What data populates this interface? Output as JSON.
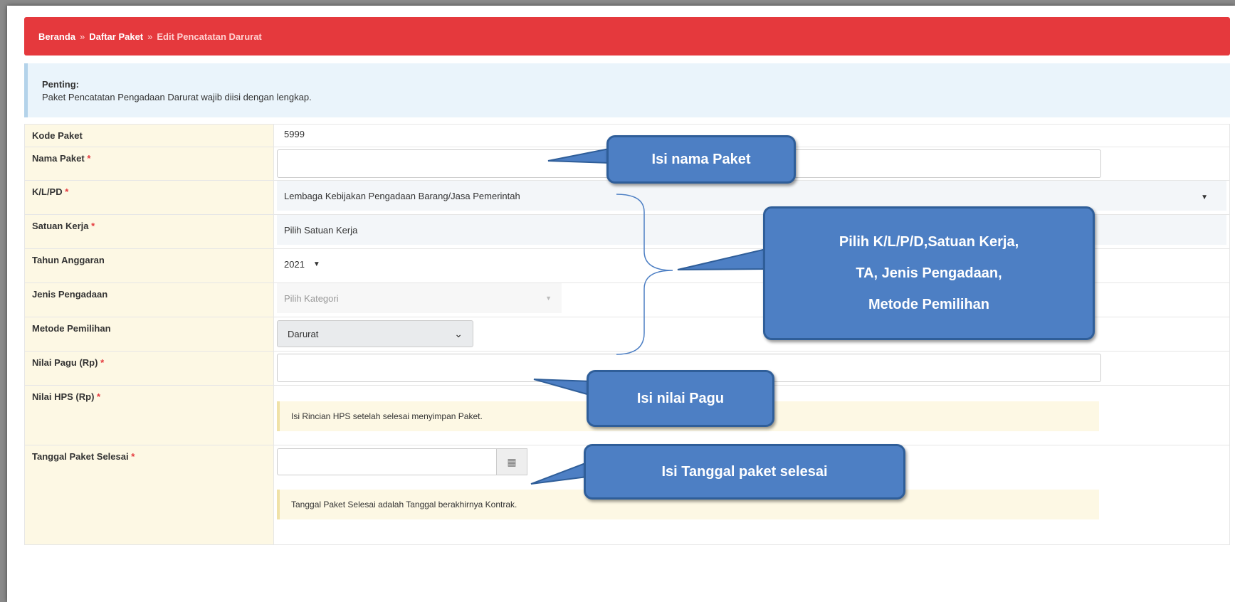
{
  "breadcrumb": {
    "home": "Beranda",
    "list": "Daftar Paket",
    "current": "Edit Pencatatan Darurat",
    "sep": "»"
  },
  "alert": {
    "title": "Penting:",
    "text": "Paket Pencatatan Pengadaan Darurat wajib diisi dengan lengkap."
  },
  "form": {
    "kode_label": "Kode Paket",
    "kode_value": "5999",
    "nama_label": "Nama Paket",
    "klpd_label": "K/L/PD",
    "klpd_value": "Lembaga Kebijakan Pengadaan Barang/Jasa Pemerintah",
    "satker_label": "Satuan Kerja",
    "satker_value": "Pilih Satuan Kerja",
    "tahun_label": "Tahun Anggaran",
    "tahun_value": "2021",
    "jenis_label": "Jenis Pengadaan",
    "jenis_value": "Pilih Kategori",
    "metode_label": "Metode Pemilihan",
    "metode_value": "Darurat",
    "pagu_label": "Nilai Pagu (Rp)",
    "hps_label": "Nilai HPS (Rp)",
    "hps_note": "Isi Rincian HPS setelah selesai menyimpan Paket.",
    "tanggal_label": "Tanggal Paket Selesai",
    "tanggal_note": "Tanggal Paket Selesai adalah Tanggal berakhirnya Kontrak.",
    "required_mark": "*"
  },
  "callouts": {
    "nama": "Isi nama Paket",
    "pilih_line1": "Pilih K/L/P/D,Satuan Kerja,",
    "pilih_line2": "TA, Jenis Pengadaan,",
    "pilih_line3": "Metode Pemilihan",
    "pagu": "Isi nilai Pagu",
    "tanggal": "Isi Tanggal paket selesai"
  },
  "colors": {
    "header": "#e5393d",
    "callout": "#4d7fc4",
    "label_bg": "#fdf8e4"
  }
}
